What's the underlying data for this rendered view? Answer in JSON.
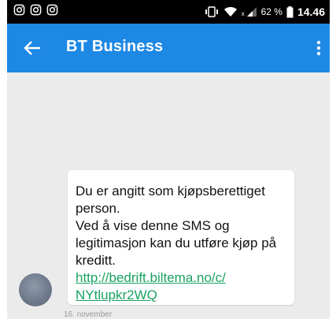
{
  "status_bar": {
    "icons": [
      "instagram-icon",
      "instagram-icon",
      "instagram-icon",
      "vibrate-icon",
      "wifi-icon",
      "signal-icon",
      "battery-icon"
    ],
    "signal_label": "x",
    "battery": "62 %",
    "time": "14.46"
  },
  "app_bar": {
    "title": "BT Business",
    "color": "#1e88e5"
  },
  "message": {
    "line1": "Du er angitt som kjøpsberettiget person.",
    "line2": "Ved å vise denne SMS og legitimasjon kan du utføre kjøp på kreditt.",
    "link": "http://bedrift.biltema.no/c/NYtlupkr2WQ",
    "date": "16. november"
  },
  "colors": {
    "link": "#1aa260",
    "background": "#ebebeb"
  }
}
